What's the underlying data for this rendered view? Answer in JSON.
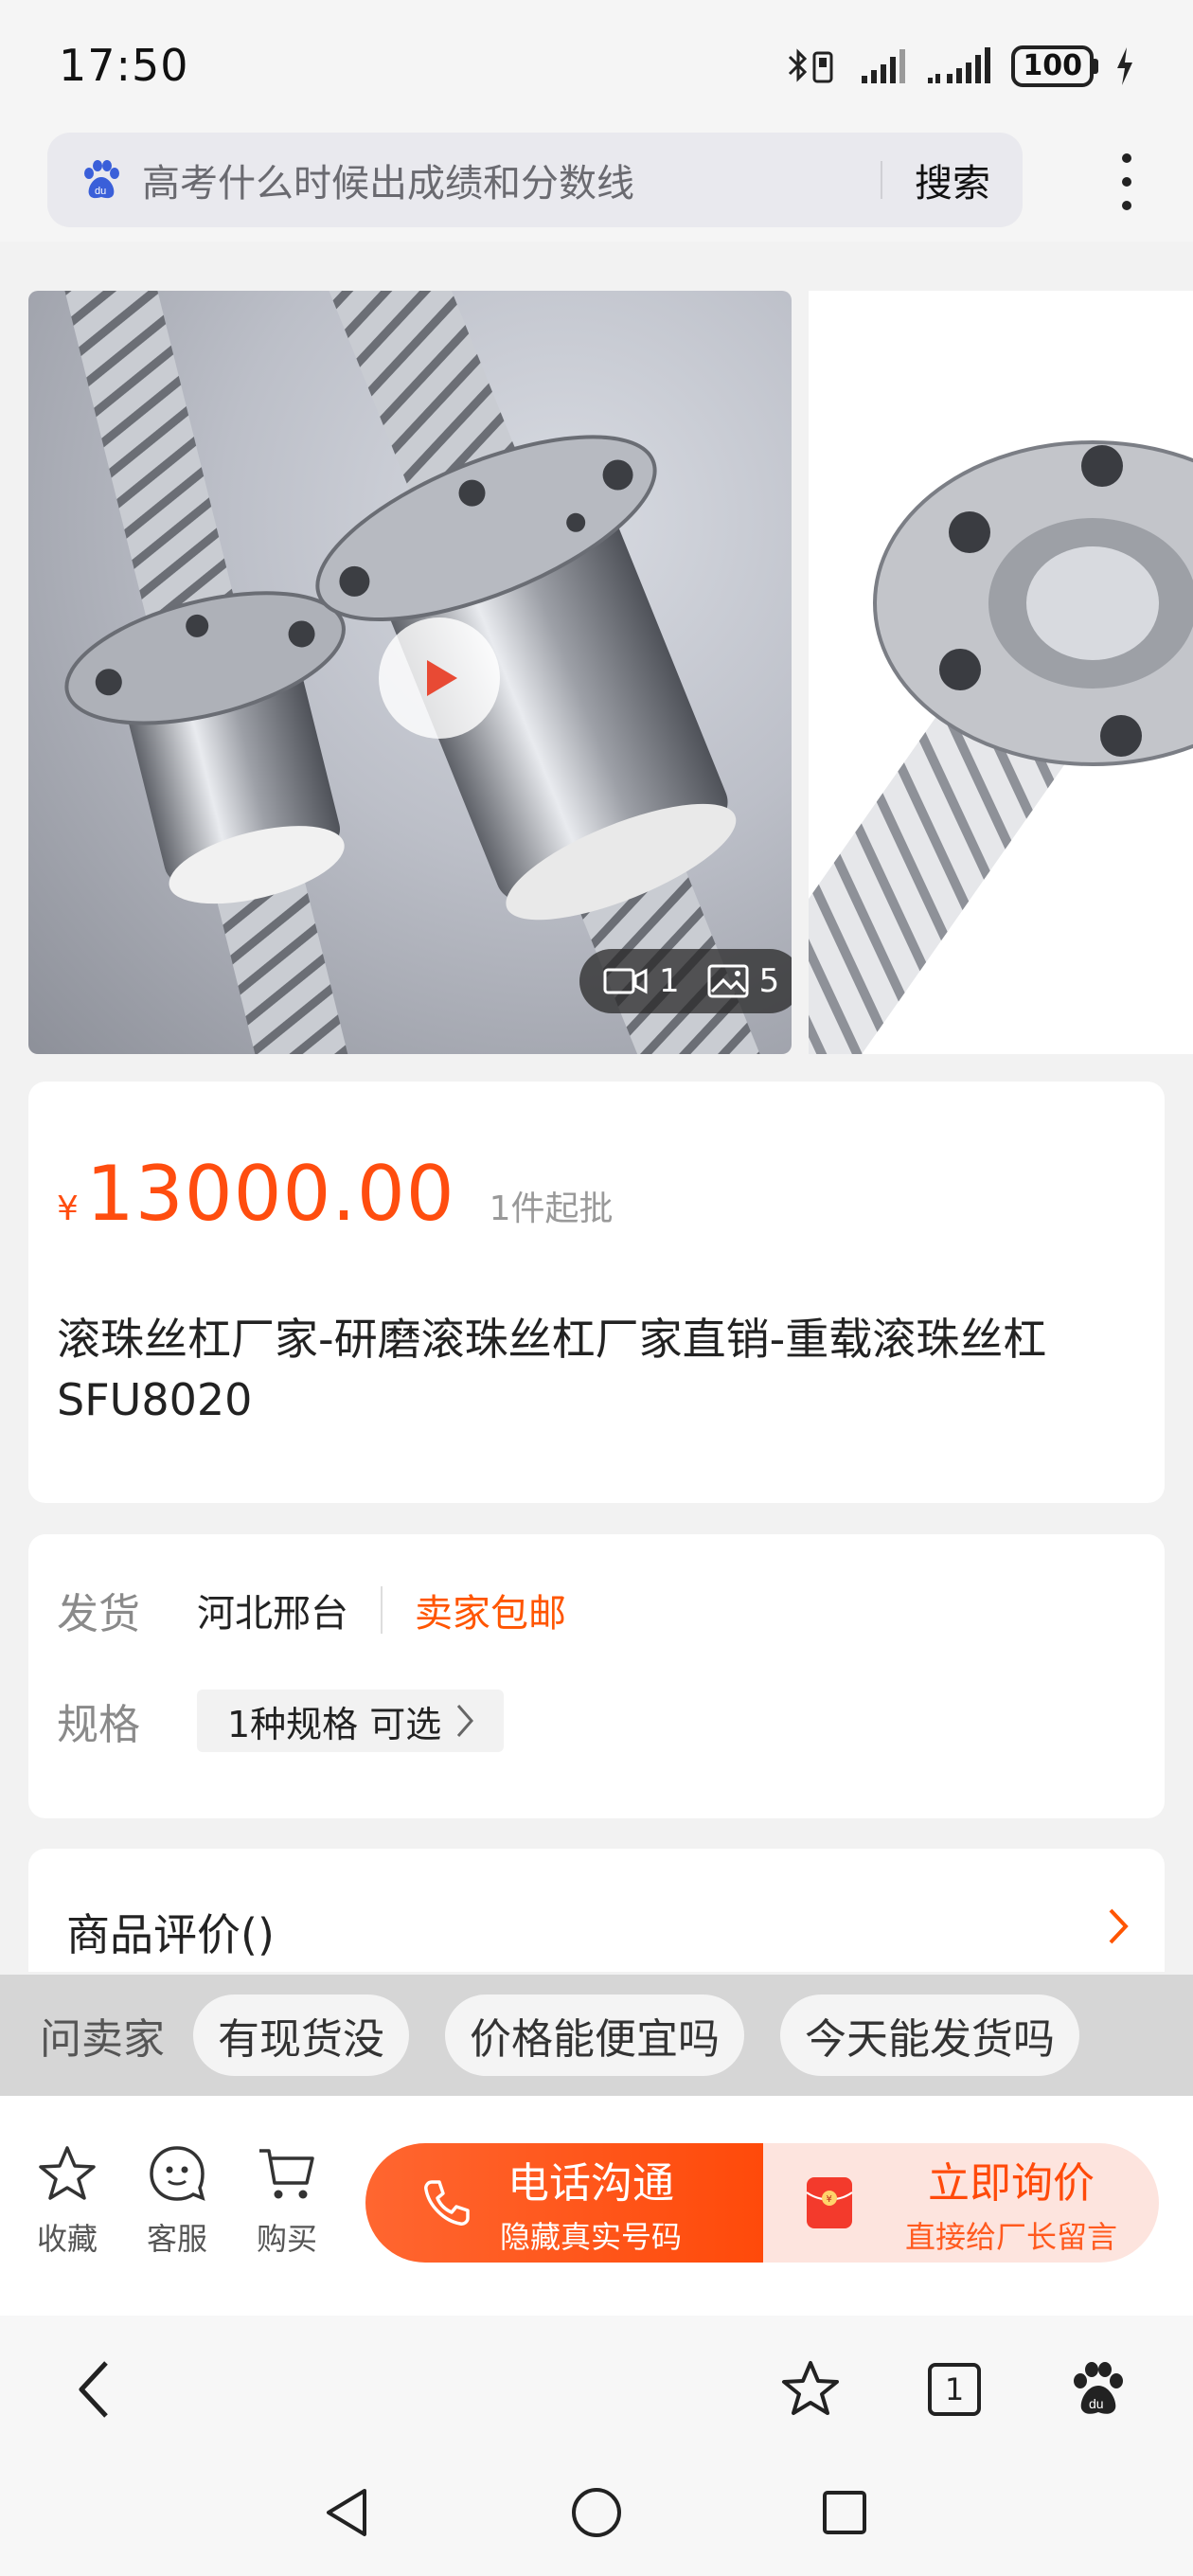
{
  "status_bar": {
    "time": "17:50",
    "battery": "100"
  },
  "search": {
    "query": "高考什么时候出成绩和分数线",
    "button_label": "搜索"
  },
  "gallery": {
    "video_count": "1",
    "image_count": "5"
  },
  "product": {
    "price_symbol": "¥",
    "price": "13000.00",
    "min_order": "1件起批",
    "title": "滚珠丝杠厂家-研磨滚珠丝杠厂家直销-重载滚珠丝杠SFU8020"
  },
  "shipping": {
    "label": "发货",
    "origin": "河北邢台",
    "free_shipping": "卖家包邮"
  },
  "spec": {
    "label": "规格",
    "value": "1种规格 可选"
  },
  "reviews": {
    "title": "商品评价()"
  },
  "ask_seller": {
    "label": "问卖家",
    "questions": [
      "有现货没",
      "价格能便宜吗",
      "今天能发货吗"
    ]
  },
  "actions": {
    "favorite": "收藏",
    "service": "客服",
    "buy": "购买",
    "call_title": "电话沟通",
    "call_sub": "隐藏真实号码",
    "inquiry_title": "立即询价",
    "inquiry_sub": "直接给厂长留言"
  },
  "browser_nav": {
    "tab_count": "1"
  },
  "colors": {
    "accent": "#ff4d0f",
    "call_button": "#ff5120",
    "inquiry_bg": "#fde4de"
  }
}
